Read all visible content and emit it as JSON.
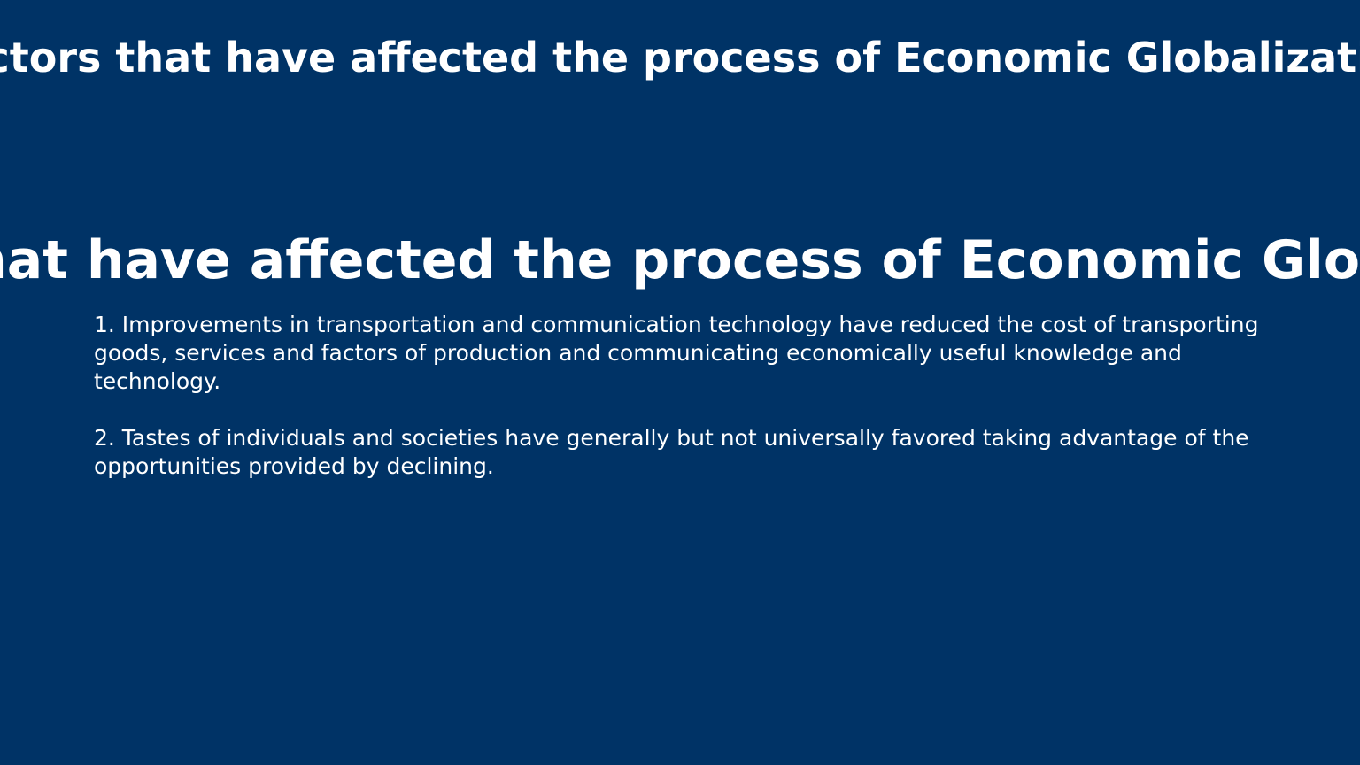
{
  "slide": {
    "header_title": "Factors that have affected the process of Economic Globalization",
    "main_title": "Factors that have affected the process of Economic Globalization",
    "points": [
      "1. Improvements in transportation and communication technology have reduced the cost of transporting goods, services and factors of production and communicating economically useful knowledge and technology.",
      "2. Tastes of individuals and societies have generally but not universally favored taking advantage of the opportunities provided by declining."
    ],
    "colors": {
      "background": "#003366",
      "text": "#ffffff"
    }
  }
}
